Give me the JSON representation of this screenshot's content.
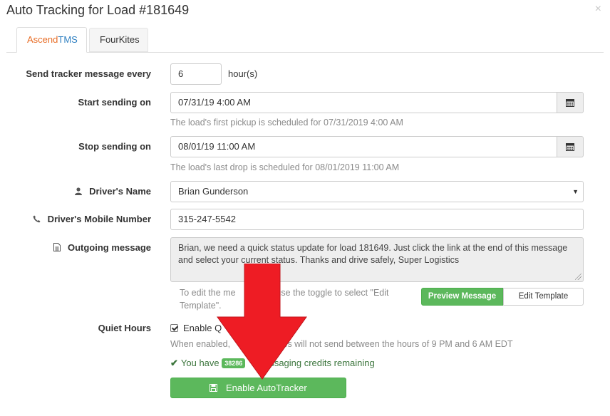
{
  "modal": {
    "title": "Auto Tracking for Load #181649",
    "close_glyph": "×"
  },
  "tabs": {
    "ascend_part1": "Ascend",
    "ascend_part2": "TMS",
    "fourkites": "FourKites",
    "brand_orange": "#e86d26",
    "brand_blue": "#2e7fc1"
  },
  "form": {
    "interval": {
      "label": "Send tracker message every",
      "value": "6",
      "unit": "hour(s)"
    },
    "start": {
      "label": "Start sending on",
      "value": "07/31/19 4:00 AM",
      "help": "The load's first pickup is scheduled for 07/31/2019 4:00 AM",
      "icon": "calendar-icon"
    },
    "stop": {
      "label": "Stop sending on",
      "value": "08/01/19 11:00 AM",
      "help": "The load's last drop is scheduled for 08/01/2019 11:00 AM",
      "icon": "calendar-icon"
    },
    "driver_name": {
      "label": "Driver's Name",
      "value": "Brian Gunderson",
      "icon": "user-icon"
    },
    "driver_phone": {
      "label": "Driver's Mobile Number",
      "value": "315-247-5542",
      "icon": "phone-icon"
    },
    "outgoing": {
      "label": "Outgoing message",
      "icon": "document-icon",
      "value": "Brian, we need a quick status update for load 181649. Just click the link at the end of this message and select your current status. Thanks and drive safely, Super Logistics",
      "help_before": "To edit the me",
      "help_after": "use the toggle to select \"Edit Template\".",
      "preview_label": "Preview Message",
      "edit_label": "Edit Template"
    },
    "quiet": {
      "label": "Quiet Hours",
      "checkbox_label": "Enable Q",
      "checked": true,
      "help_before": "When enabled,",
      "help_after": "ssages will not send between the hours of 9 PM and 6 AM EDT"
    },
    "credits": {
      "before": "You have",
      "count": "38286",
      "after": "ssaging credits remaining"
    },
    "submit_label": "Enable AutoTracker"
  },
  "colors": {
    "success": "#5cb85c",
    "arrow": "#ee1c24"
  }
}
